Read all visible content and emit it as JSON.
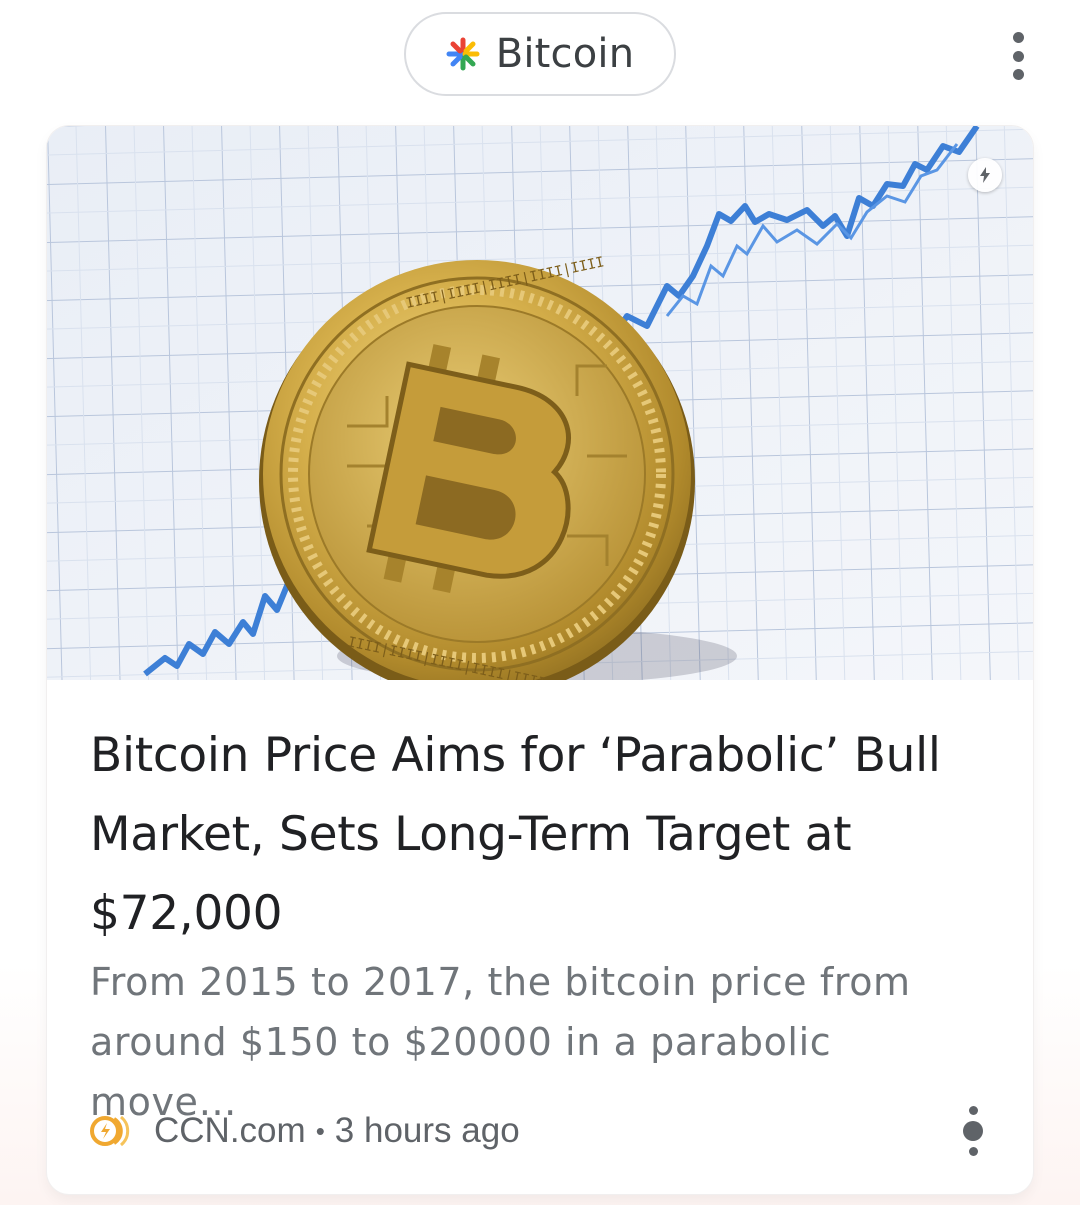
{
  "topic_chip": {
    "label": "Bitcoin",
    "icon": "google-spark-icon"
  },
  "header": {
    "menu_icon": "more-vert-icon"
  },
  "card": {
    "image_alt_icon": "bitcoin-coin-on-rising-chart",
    "amp_icon": "lightning-bolt-icon",
    "headline": "Bitcoin Price Aims for ‘Parabolic’ Bull Market, Sets Long-Term Target at $72,000",
    "snippet": "From 2015 to 2017, the bitcoin price from around $150 to $20000 in a parabolic move…",
    "publisher": "CCN.com",
    "separator": "•",
    "time": "3 hours ago",
    "publisher_icon": "ccn-logo-icon",
    "menu_icon": "more-vert-icon"
  },
  "colors": {
    "accent_blue": "#4285f4",
    "accent_red": "#ea4335",
    "accent_yellow": "#fbbc05",
    "accent_green": "#34a853",
    "chart_line": "#3d7fd6",
    "coin_gold": "#c9a43c"
  }
}
